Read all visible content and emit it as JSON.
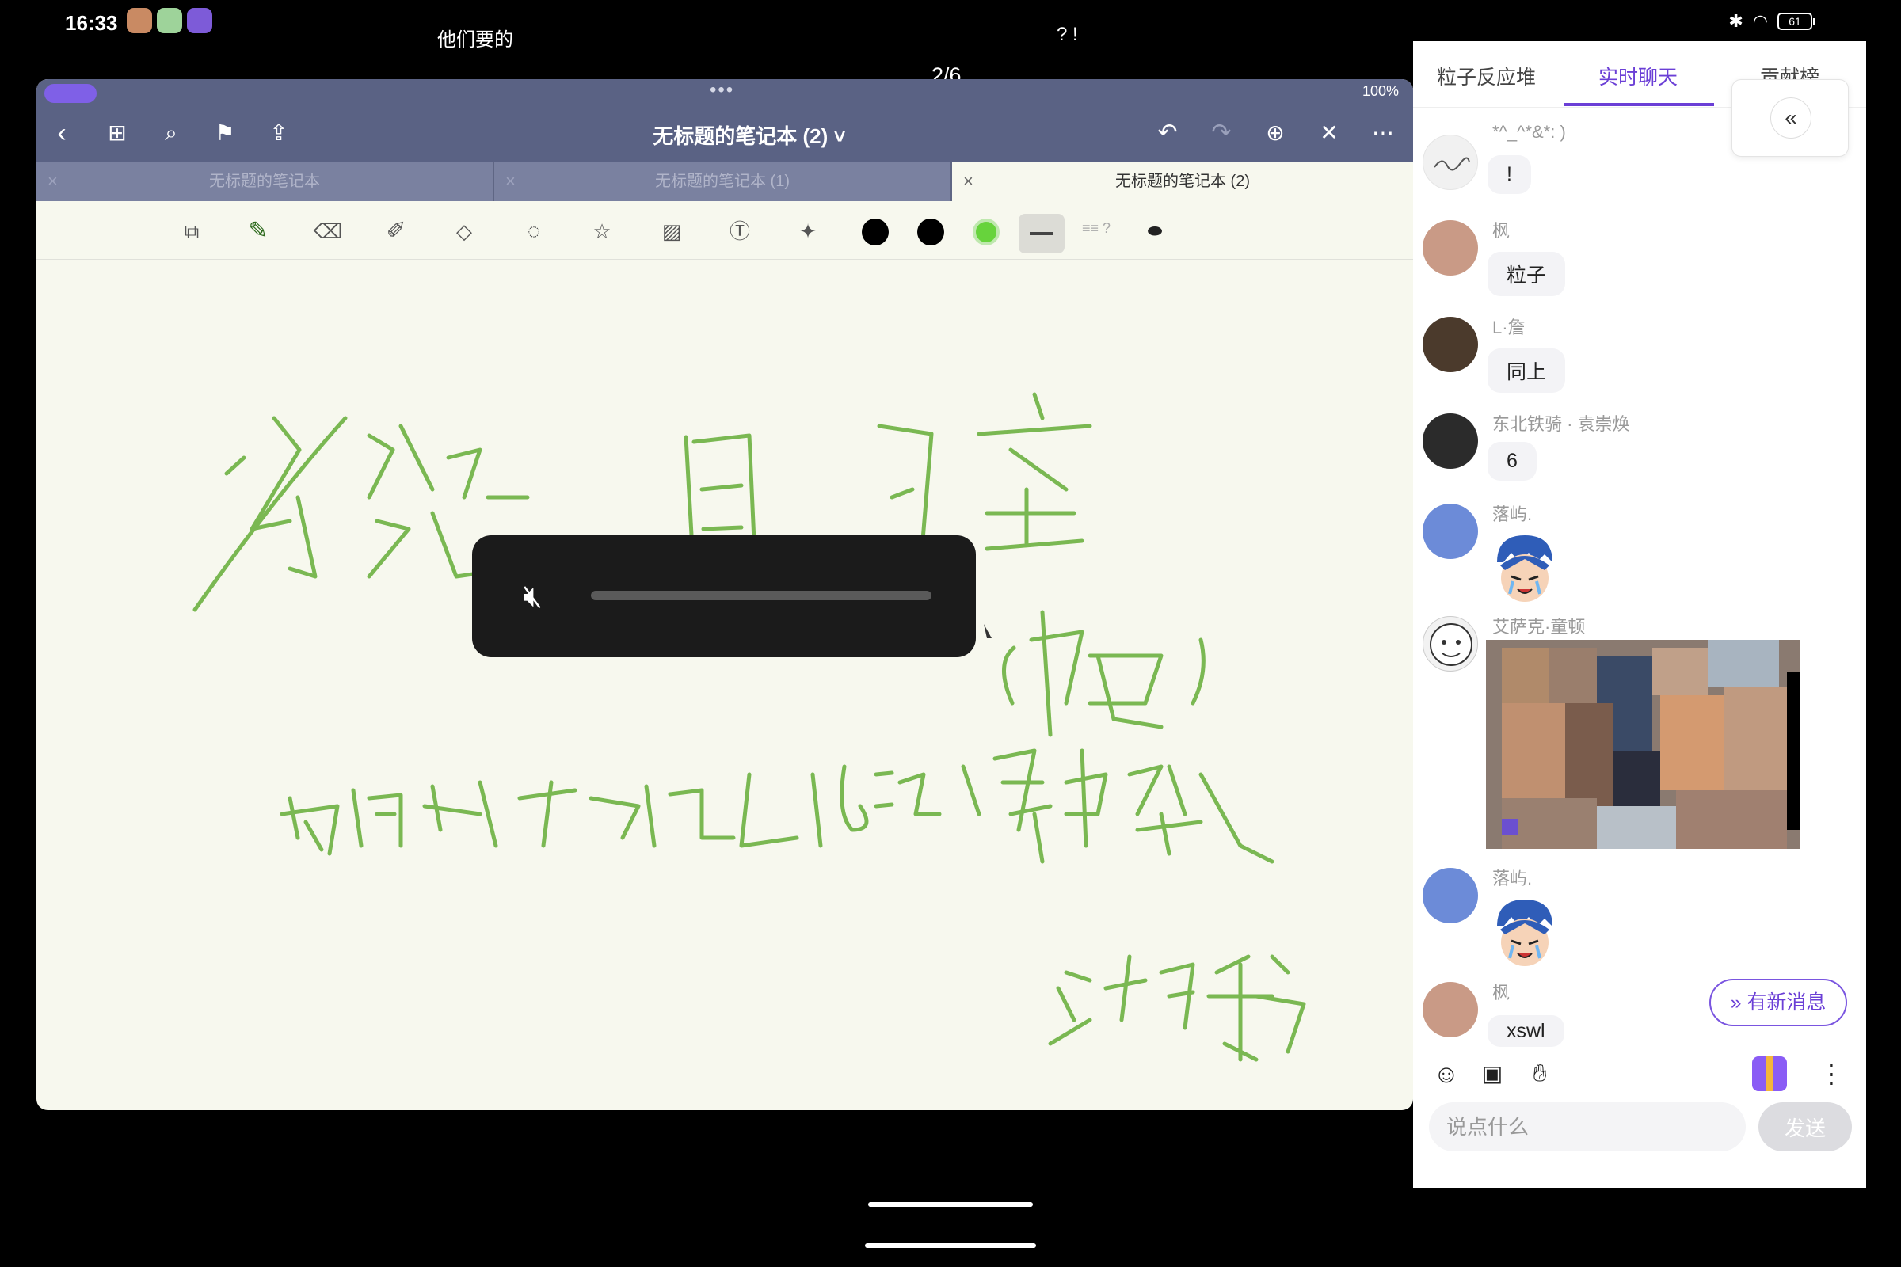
{
  "status_bar": {
    "time": "16:33",
    "battery": "61"
  },
  "overlay": {
    "top_left_text": "他们要的",
    "top_right_text": "? !",
    "page_indicator": "2/6"
  },
  "notes_app": {
    "ipad_battery": "100%",
    "doc_title": "无标题的笔记本 (2) ˅",
    "tabs": [
      {
        "label": "无标题的笔记本"
      },
      {
        "label": "无标题的笔记本 (1)"
      },
      {
        "label": "无标题的笔记本 (2)"
      }
    ],
    "pen_color": "#7ab852"
  },
  "handwriting": {
    "title": "答疑自习室",
    "subject": "(物理)",
    "note": "有问题可发评论区, 16:50 集中答疑",
    "footer": "没有午导"
  },
  "volume_hud": {
    "muted": true,
    "level": 0
  },
  "chat": {
    "tabs": [
      {
        "label": "粒子反应堆"
      },
      {
        "label": "实时聊天"
      },
      {
        "label": "贡献榜"
      }
    ],
    "messages": [
      {
        "nick": "*^_^*&*: )",
        "text": "!"
      },
      {
        "nick": "枫",
        "text": "粒子"
      },
      {
        "nick": "L·詹",
        "text": "同上"
      },
      {
        "nick": "东北铁骑 · 袁崇焕",
        "text": "6"
      },
      {
        "nick": "落屿.",
        "text": ""
      },
      {
        "nick": "艾萨克·童顿",
        "text": ""
      },
      {
        "nick": "落屿.",
        "text": ""
      },
      {
        "nick": "枫",
        "text": "xswl"
      }
    ],
    "new_messages_label": "有新消息",
    "input_placeholder": "说点什么",
    "send_label": "发送",
    "accent_color": "#6b3fd6"
  }
}
